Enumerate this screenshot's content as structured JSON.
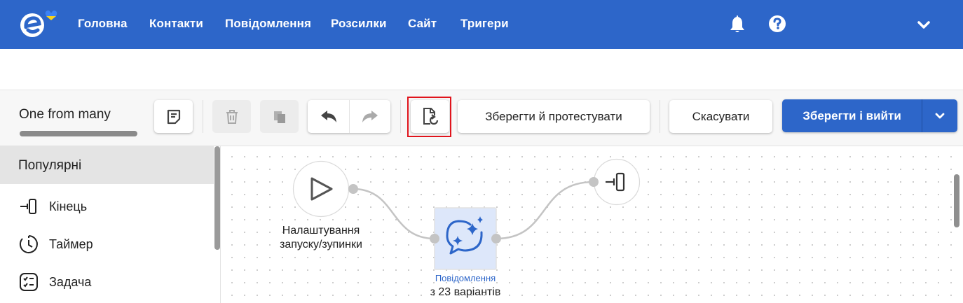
{
  "nav": {
    "items": [
      "Головна",
      "Контакти",
      "Повідомлення",
      "Розсилки",
      "Сайт",
      "Тригери"
    ],
    "brand_color": "#2d66c9",
    "icons": [
      "bell-icon",
      "help-icon",
      "chevron-down-icon"
    ]
  },
  "toolbar": {
    "flow_name": "One from many",
    "save_test_label": "Зберегти й протестувати",
    "cancel_label": "Скасувати",
    "save_exit_label": "Зберегти і вийти",
    "icons": [
      "note-icon",
      "trash-icon",
      "copy-icon",
      "undo-icon",
      "redo-icon",
      "restore-version-icon"
    ],
    "highlight_color": "#e0141c"
  },
  "sidebar": {
    "category": "Популярні",
    "items": [
      {
        "label": "Кінець",
        "icon": "end-icon"
      },
      {
        "label": "Таймер",
        "icon": "timer-icon"
      },
      {
        "label": "Задача",
        "icon": "task-icon"
      }
    ]
  },
  "flow": {
    "start_node": {
      "label_line1": "Налаштування",
      "label_line2": "запуску/зупинки",
      "icon": "play-icon"
    },
    "message_node": {
      "title": "Повідомлення",
      "subtitle": "з 23 варіантів",
      "icon": "ai-message-icon",
      "title_color": "#2d66c9"
    },
    "end_node": {
      "icon": "end-icon"
    }
  }
}
